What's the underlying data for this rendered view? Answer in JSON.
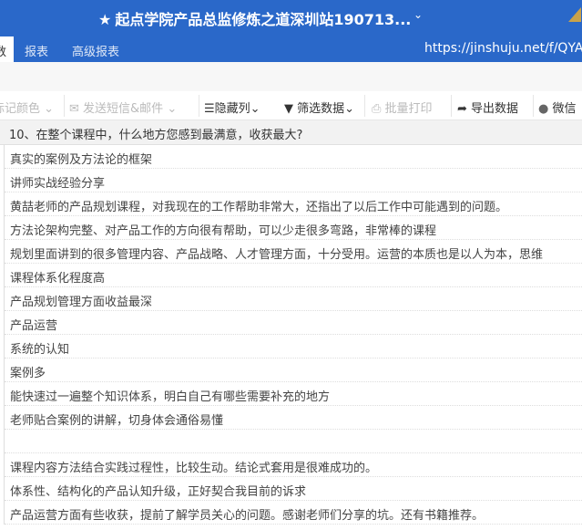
{
  "titlebar": {
    "title": "起点学院产品总监修炼之道深圳站190713...",
    "star_icon": "★",
    "chevron": "⌄"
  },
  "tabs": {
    "active": "数据",
    "items": [
      "报表",
      "高级报表"
    ],
    "url": "https://jinshuju.net/f/QYA"
  },
  "toolbar": {
    "mark_color": "标记颜色",
    "send": "发送短信&邮件",
    "hide_cols": "隐藏列",
    "filter": "筛选数据",
    "batch_print": "批量打印",
    "export": "导出数据",
    "wechat": "微信"
  },
  "table": {
    "header": "10、在整个课程中，什么地方您感到最满意，收获最大?",
    "rows": [
      "真实的案例及方法论的框架",
      "讲师实战经验分享",
      "黄喆老师的产品规划课程，对我现在的工作帮助非常大，还指出了以后工作中可能遇到的问题。",
      "方法论架构完整、对产品工作的方向很有帮助，可以少走很多弯路，非常棒的课程",
      "规划里面讲到的很多管理内容、产品战略、人才管理方面，十分受用。运营的本质也是以人为本，思维",
      "课程体系化程度高",
      "产品规划管理方面收益最深",
      "产品运营",
      "系统的认知",
      "案例多",
      "能快速过一遍整个知识体系，明白自己有哪些需要补充的地方",
      "老师贴合案例的讲解，切身体会通俗易懂",
      "",
      "课程内容方法结合实践过程性，比较生动。结论式套用是很难成功的。",
      "体系性、结构化的产品认知升级，正好契合我目前的诉求",
      "产品运营方面有些收获，提前了解学员关心的问题。感谢老师们分享的坑。还有书籍推荐。"
    ]
  }
}
